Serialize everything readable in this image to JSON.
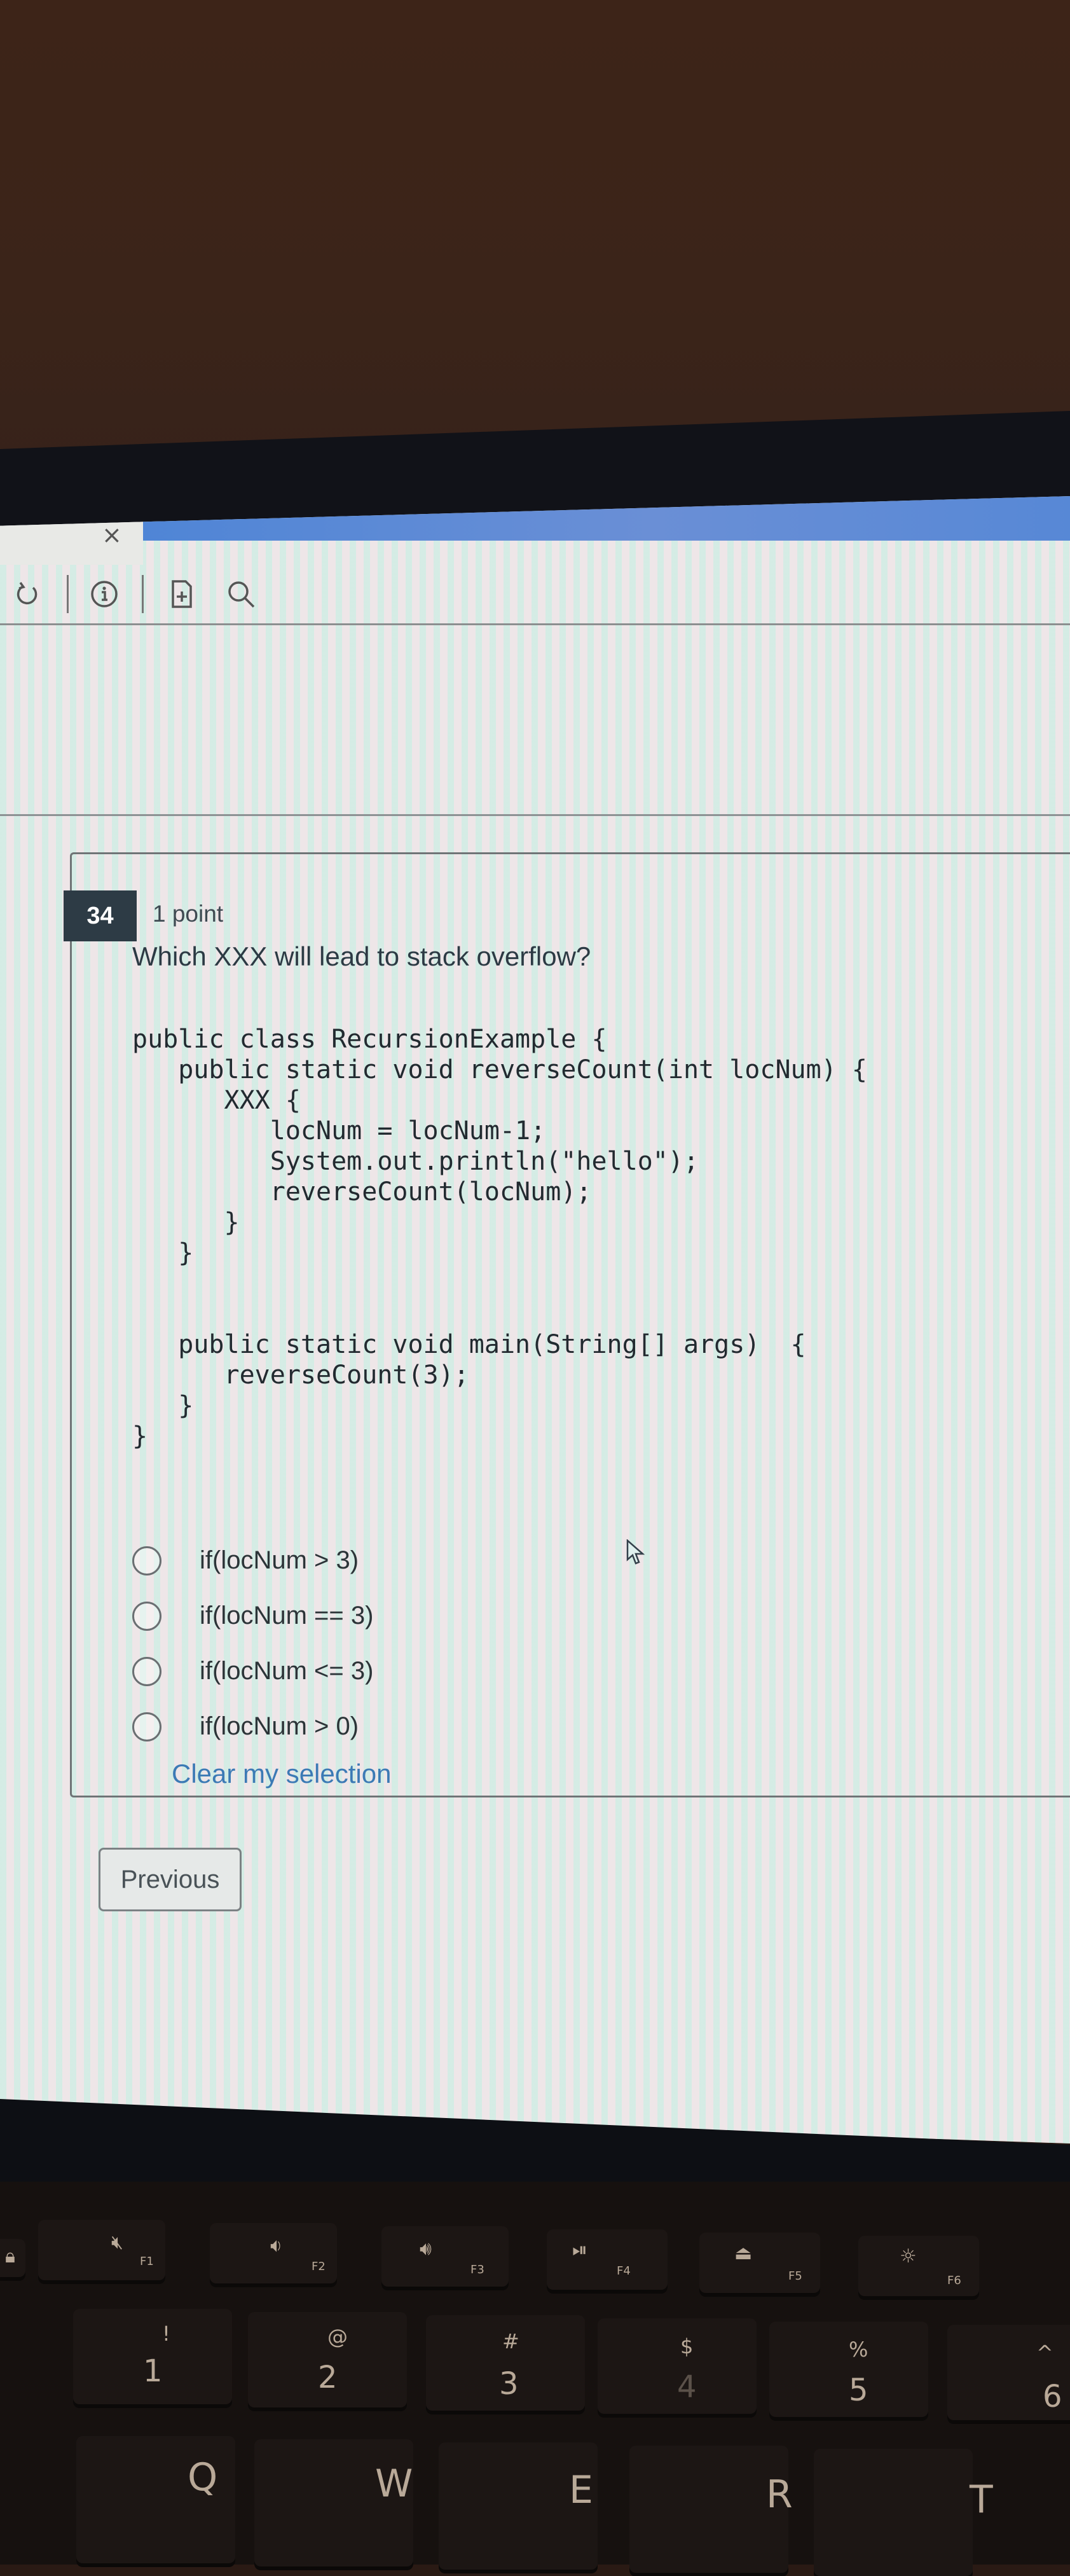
{
  "browser": {
    "tab_close_icon": "close-icon",
    "toolbar_icons": [
      "refresh-icon",
      "info-icon",
      "add-file-icon",
      "search-icon"
    ]
  },
  "question": {
    "number": "34",
    "points": "1 point",
    "prompt": "Which XXX will lead to stack overflow?",
    "code": "public class RecursionExample {\n   public static void reverseCount(int locNum) {\n      XXX {\n         locNum = locNum-1;\n         System.out.println(\"hello\");\n         reverseCount(locNum);\n      }\n   }\n\n\n   public static void main(String[] args)  {\n      reverseCount(3);\n   }\n}",
    "options": [
      {
        "label": "if(locNum > 3)",
        "selected": false
      },
      {
        "label": "if(locNum == 3)",
        "selected": false
      },
      {
        "label": "if(locNum <= 3)",
        "selected": false
      },
      {
        "label": "if(locNum > 0)",
        "selected": false
      }
    ],
    "clear_label": "Clear my selection"
  },
  "nav": {
    "previous_label": "Previous"
  },
  "keyboard": {
    "fn_keys": [
      {
        "icon": "lock-icon",
        "label": ""
      },
      {
        "icon": "mute-icon",
        "label": "F1"
      },
      {
        "icon": "volume-down-icon",
        "label": "F2"
      },
      {
        "icon": "volume-up-icon",
        "label": "F3"
      },
      {
        "icon": "play-pause-icon",
        "label": "F4"
      },
      {
        "icon": "keyboard-backlight-icon",
        "label": "F5"
      },
      {
        "icon": "brightness-down-icon",
        "label": "F6"
      }
    ],
    "number_keys": [
      {
        "shift": "!",
        "main": "1"
      },
      {
        "shift": "@",
        "main": "2"
      },
      {
        "shift": "#",
        "main": "3"
      },
      {
        "shift": "$",
        "main": "4"
      },
      {
        "shift": "%",
        "main": "5"
      },
      {
        "shift": "^",
        "main": "6"
      }
    ],
    "letter_keys": [
      "Q",
      "W",
      "E",
      "R",
      "T"
    ]
  },
  "colors": {
    "accent_blue": "#5788d6",
    "link": "#3c7ab5",
    "badge_bg": "#2d3b45"
  }
}
